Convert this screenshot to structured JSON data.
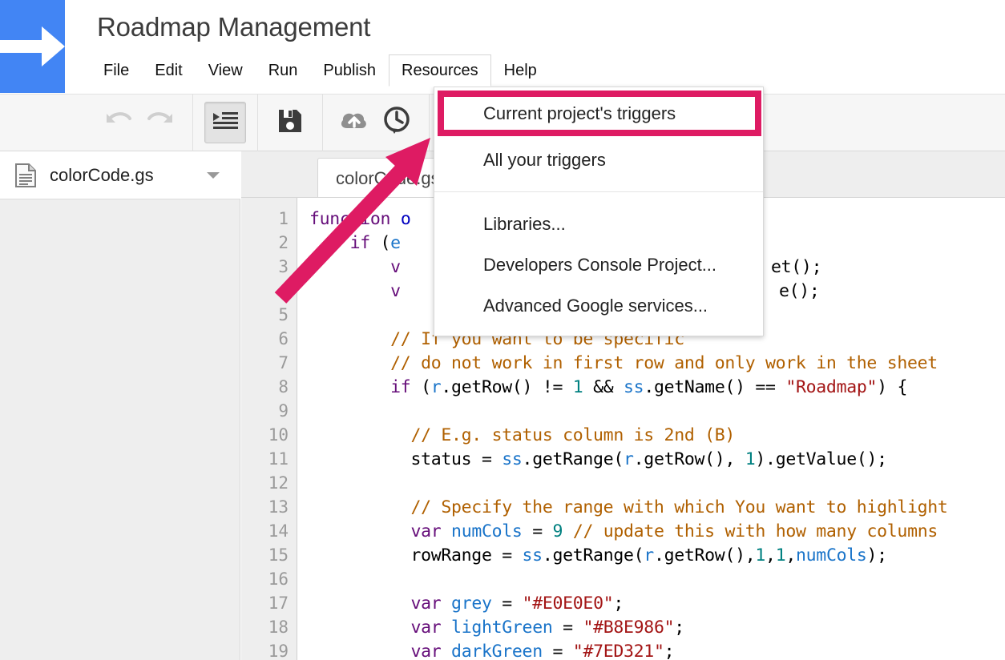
{
  "header": {
    "logo_icon": "apps-script-arrow-logo",
    "logo_color": "#4285F4",
    "project_title": "Roadmap Management",
    "menu_items": [
      {
        "label": "File",
        "active": false
      },
      {
        "label": "Edit",
        "active": false
      },
      {
        "label": "View",
        "active": false
      },
      {
        "label": "Run",
        "active": false
      },
      {
        "label": "Publish",
        "active": false
      },
      {
        "label": "Resources",
        "active": true
      },
      {
        "label": "Help",
        "active": false
      }
    ]
  },
  "toolbar": {
    "buttons": [
      {
        "name": "undo-button",
        "icon": "undo-icon",
        "state": "disabled"
      },
      {
        "name": "redo-button",
        "icon": "redo-icon",
        "state": "disabled"
      },
      {
        "name": "format-code-button",
        "icon": "indent-lines-icon",
        "state": "pressed"
      },
      {
        "name": "save-button",
        "icon": "floppy-disk-icon",
        "state": "enabled"
      },
      {
        "name": "publish-button",
        "icon": "cloud-upload-icon",
        "state": "disabled"
      },
      {
        "name": "version-history-button",
        "icon": "clock-history-icon",
        "state": "enabled"
      },
      {
        "name": "run-button",
        "icon": "play-triangle-icon",
        "state": "enabled"
      }
    ]
  },
  "sidebar": {
    "file_icon": "script-file-icon",
    "file_name": "colorCode.gs",
    "caret_icon": "chevron-down-icon"
  },
  "editor": {
    "tab_label": "colorCode.gs",
    "line_numbers": [
      1,
      2,
      3,
      4,
      5,
      6,
      7,
      8,
      9,
      10,
      11,
      12,
      13,
      14,
      15,
      16,
      17,
      18,
      19
    ]
  },
  "dropdown": {
    "highlighted_item": "Current project's triggers",
    "highlight_color": "#DE1B63",
    "items": [
      "All your triggers",
      "Libraries...",
      "Developers Console Project...",
      "Advanced Google services..."
    ]
  },
  "annotation": {
    "arrow_color": "#DE1B63",
    "arrow_direction": "up-right"
  }
}
